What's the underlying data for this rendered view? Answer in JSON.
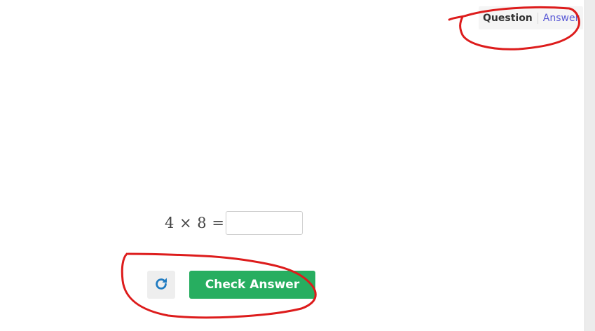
{
  "tabs": {
    "question_label": "Question",
    "answer_label": "Answer"
  },
  "problem": {
    "expression": "4 × 8 =",
    "answer_value": ""
  },
  "actions": {
    "reset_icon": "refresh-icon",
    "check_label": "Check Answer"
  },
  "colors": {
    "check_button": "#27ae60",
    "answer_tab": "#5b5bd6",
    "reset_icon": "#1f7bc1",
    "annotation": "#dd1c1c"
  }
}
